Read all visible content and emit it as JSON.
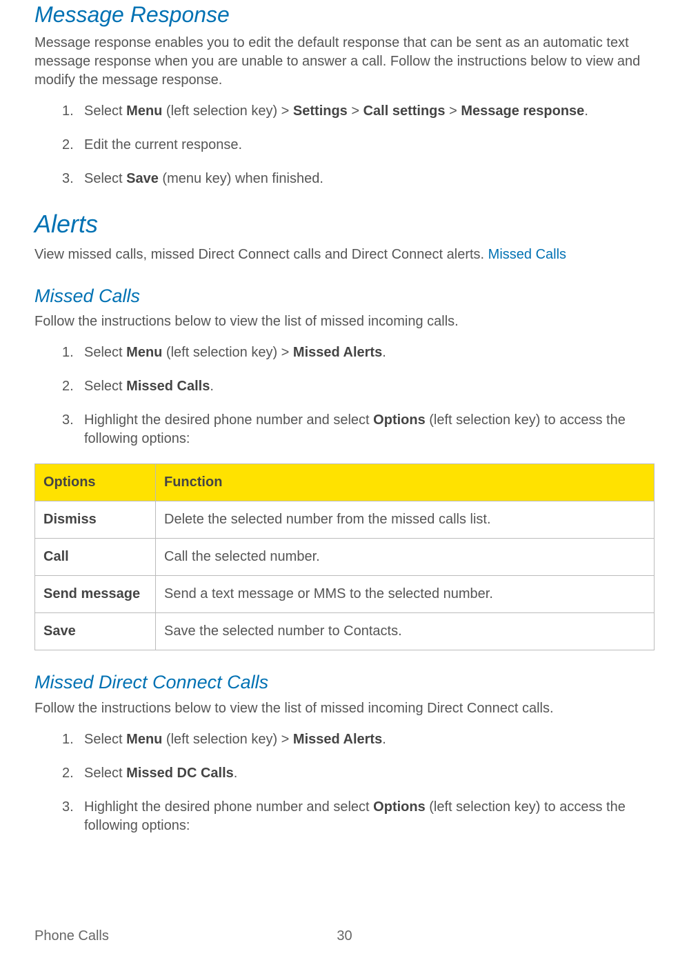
{
  "section1": {
    "title": "Message Response",
    "intro": "Message response enables you to edit the default response that can be sent as an automatic text message response when you are unable to answer a call. Follow the instructions below to view and modify the message response.",
    "steps": [
      {
        "pre": "Select ",
        "b1": "Menu",
        "mid1": " (left selection key) > ",
        "b2": "Settings",
        "mid2": " > ",
        "b3": "Call settings",
        "mid3": " > ",
        "b4": "Message response",
        "post": "."
      },
      {
        "text": "Edit the current response."
      },
      {
        "pre": "Select ",
        "b1": "Save",
        "post": " (menu key) when finished."
      }
    ]
  },
  "section2": {
    "title": "Alerts",
    "intro_pre": "View missed calls, missed Direct Connect calls and Direct Connect alerts. ",
    "intro_link": "Missed Calls"
  },
  "section3": {
    "title": "Missed Calls",
    "intro": "Follow the instructions below to view the list of missed incoming calls.",
    "steps": [
      {
        "pre": "Select ",
        "b1": "Menu",
        "mid1": " (left selection key) > ",
        "b2": "Missed Alerts",
        "post": "."
      },
      {
        "pre": "Select ",
        "b1": "Missed Calls",
        "post": "."
      },
      {
        "pre": "Highlight the desired phone number and select ",
        "b1": "Options",
        "post": " (left selection key) to access the following options:"
      }
    ]
  },
  "table": {
    "header": [
      "Options",
      "Function"
    ],
    "rows": [
      [
        "Dismiss",
        "Delete the selected number from the missed calls list."
      ],
      [
        "Call",
        "Call the selected number."
      ],
      [
        "Send message",
        "Send a text message or MMS to the selected number."
      ],
      [
        "Save",
        "Save the selected number to Contacts."
      ]
    ]
  },
  "section4": {
    "title": "Missed Direct Connect Calls",
    "intro": "Follow the instructions below to view the list of missed incoming Direct Connect calls.",
    "steps": [
      {
        "pre": "Select ",
        "b1": "Menu",
        "mid1": " (left selection key) > ",
        "b2": "Missed Alerts",
        "post": "."
      },
      {
        "pre": "Select ",
        "b1": "Missed DC Calls",
        "post": "."
      },
      {
        "pre": "Highlight the desired phone number and select ",
        "b1": "Options",
        "post": " (left selection key) to access the following options:"
      }
    ]
  },
  "footer": {
    "section": "Phone Calls",
    "page": "30"
  }
}
